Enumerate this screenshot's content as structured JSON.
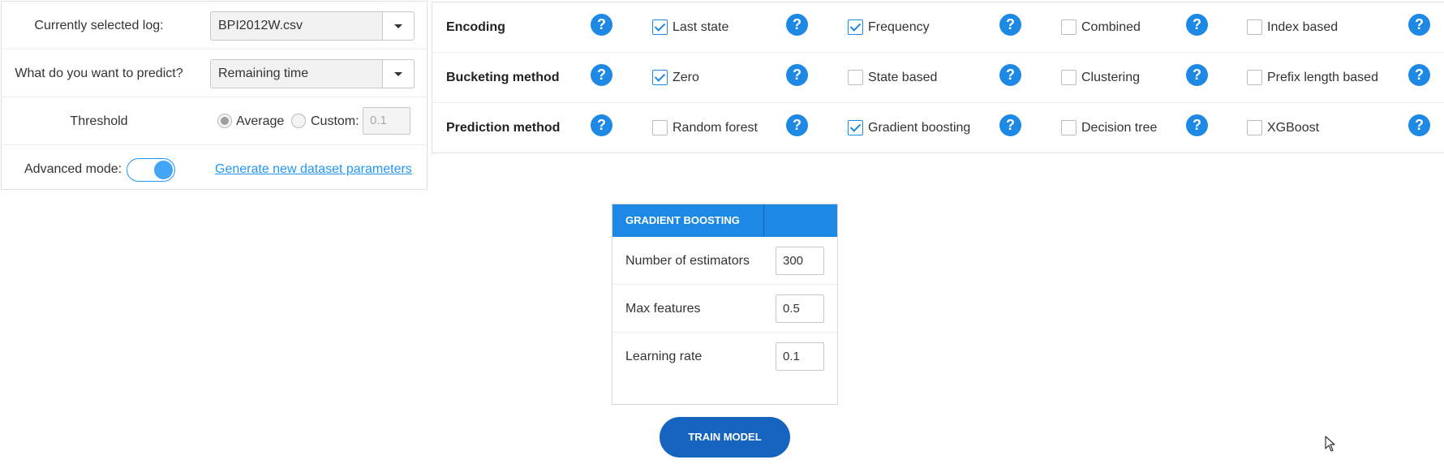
{
  "left_panel": {
    "log": {
      "label": "Currently selected log:",
      "value": "BPI2012W.csv"
    },
    "predict": {
      "label": "What do you want to predict?",
      "value": "Remaining time"
    },
    "threshold": {
      "label": "Threshold",
      "average_label": "Average",
      "custom_label": "Custom:",
      "custom_value": "0.1",
      "selected": "Average"
    },
    "advanced": {
      "label": "Advanced mode:",
      "enabled": true,
      "link": "Generate new dataset parameters"
    }
  },
  "methods": {
    "help_symbol": "?",
    "rows": [
      {
        "label": "Encoding",
        "options": [
          {
            "label": "Last state",
            "checked": true
          },
          {
            "label": "Frequency",
            "checked": true
          },
          {
            "label": "Combined",
            "checked": false
          },
          {
            "label": "Index based",
            "checked": false
          }
        ]
      },
      {
        "label": "Bucketing method",
        "options": [
          {
            "label": "Zero",
            "checked": true
          },
          {
            "label": "State based",
            "checked": false
          },
          {
            "label": "Clustering",
            "checked": false
          },
          {
            "label": "Prefix length based",
            "checked": false
          }
        ]
      },
      {
        "label": "Prediction method",
        "options": [
          {
            "label": "Random forest",
            "checked": false
          },
          {
            "label": "Gradient boosting",
            "checked": true
          },
          {
            "label": "Decision tree",
            "checked": false
          },
          {
            "label": "XGBoost",
            "checked": false
          }
        ]
      }
    ]
  },
  "gb_card": {
    "title": "GRADIENT BOOSTING",
    "fields": [
      {
        "label": "Number of estimators",
        "value": "300"
      },
      {
        "label": "Max features",
        "value": "0.5"
      },
      {
        "label": "Learning rate",
        "value": "0.1"
      }
    ]
  },
  "train_button": "TRAIN MODEL",
  "colors": {
    "accent": "#1e88e5",
    "button": "#1565c0"
  }
}
